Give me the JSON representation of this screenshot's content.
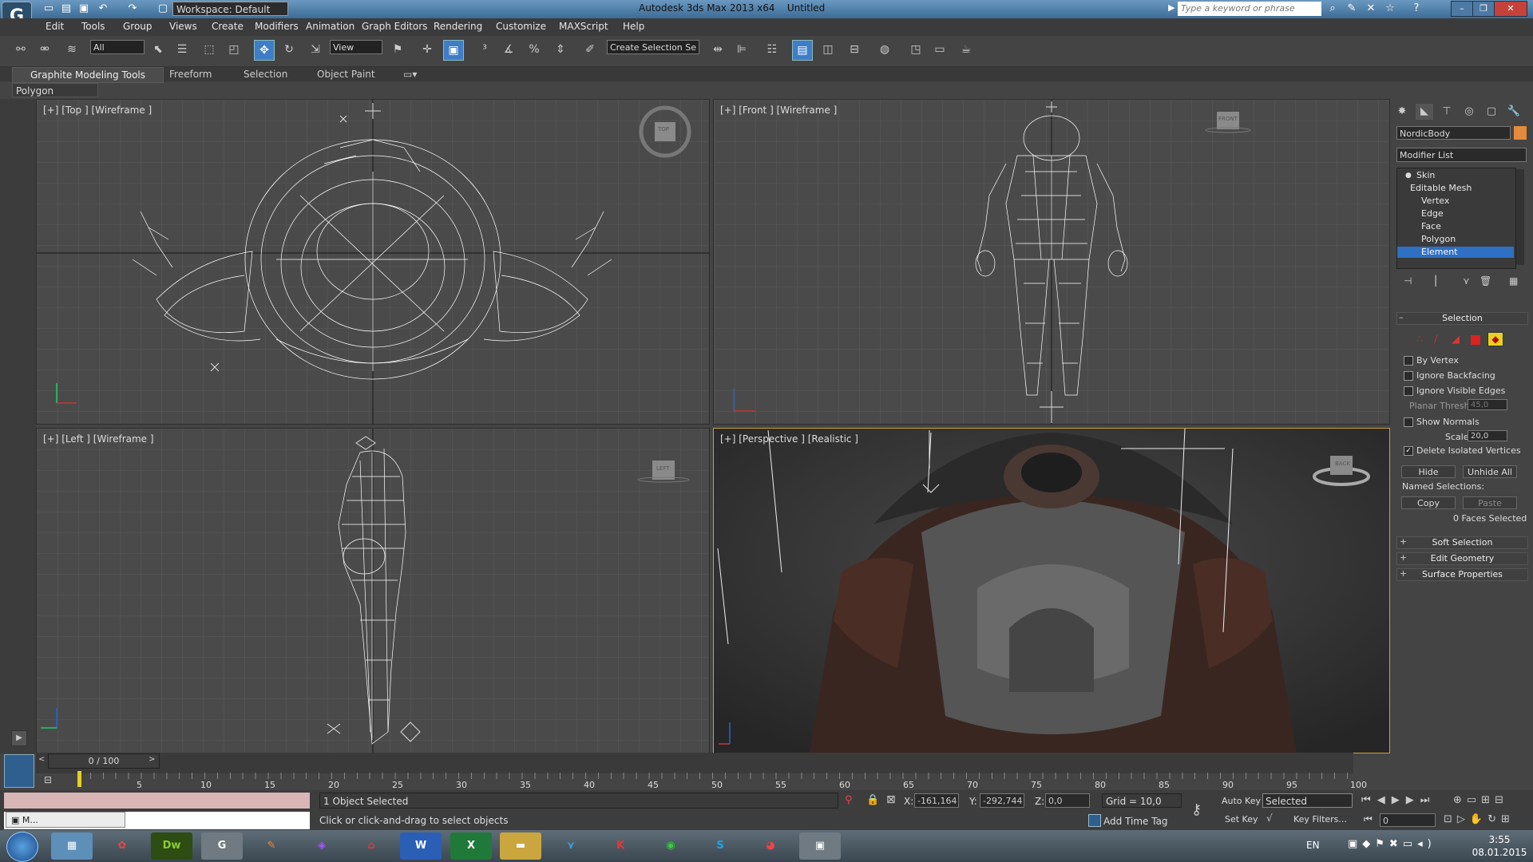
{
  "titlebar": {
    "workspace": "Workspace: Default",
    "app_title": "Autodesk 3ds Max  2013 x64",
    "doc_title": "Untitled",
    "search_placeholder": "Type a keyword or phrase"
  },
  "menu": [
    "Edit",
    "Tools",
    "Group",
    "Views",
    "Create",
    "Modifiers",
    "Animation",
    "Graph Editors",
    "Rendering",
    "Customize",
    "MAXScript",
    "Help"
  ],
  "toolbar": {
    "selection_filter": "All",
    "reference_coord": "View",
    "named_selection_set": "Create Selection Se"
  },
  "ribbon": {
    "tabs": [
      "Graphite Modeling Tools",
      "Freeform",
      "Selection",
      "Object Paint"
    ],
    "panel": "Polygon Modeling"
  },
  "viewports": {
    "top": {
      "label": "[+] [Top ] [Wireframe ]",
      "cube": "TOP"
    },
    "front": {
      "label": "[+] [Front ] [Wireframe ]",
      "cube": "FRONT"
    },
    "left": {
      "label": "[+] [Left ] [Wireframe ]",
      "cube": "LEFT"
    },
    "perspective": {
      "label": "[+] [Perspective ] [Realistic ]",
      "cube": "BACK"
    }
  },
  "command_panel": {
    "object_name": "NordicBody",
    "object_color": "#e58a3c",
    "modifier_list": "Modifier List",
    "stack": [
      "Skin",
      "Editable Mesh",
      "Vertex",
      "Edge",
      "Face",
      "Polygon",
      "Element"
    ],
    "selection": {
      "title": "Selection",
      "by_vertex": "By Vertex",
      "ignore_backfacing": "Ignore Backfacing",
      "ignore_visible_edges": "Ignore Visible Edges",
      "planar_thresh_label": "Planar Thresh:",
      "planar_thresh": "45,0",
      "show_normals": "Show Normals",
      "scale_label": "Scale:",
      "scale": "20,0",
      "delete_isolated": "Delete Isolated Vertices",
      "hide": "Hide",
      "unhide_all": "Unhide All",
      "named_selections": "Named Selections:",
      "copy": "Copy",
      "paste": "Paste",
      "faces_selected": "0 Faces Selected"
    },
    "rollouts": [
      "Soft Selection",
      "Edit Geometry",
      "Surface Properties"
    ]
  },
  "timeline": {
    "slider": "0 / 100",
    "ticks": [
      "5",
      "10",
      "15",
      "20",
      "25",
      "30",
      "35",
      "40",
      "45",
      "50",
      "55",
      "60",
      "65",
      "70",
      "75",
      "80",
      "85",
      "90",
      "95",
      "100"
    ]
  },
  "status": {
    "selection": "1 Object Selected",
    "prompt": "Click or click-and-drag to select objects",
    "x_label": "X:",
    "x": "-161,164",
    "y_label": "Y:",
    "y": "-292,744",
    "z_label": "Z:",
    "z": "0,0",
    "grid": "Grid = 10,0",
    "add_time_tag": "Add Time Tag",
    "auto_key": "Auto Key",
    "set_key": "Set Key",
    "key_mode": "Selected",
    "key_filters": "Key Filters...",
    "frame": "0",
    "mini_listener": "M..."
  },
  "taskbar": {
    "lang": "EN",
    "time": "3:55",
    "date": "08.01.2015",
    "apps": [
      "Dw",
      "W",
      "X",
      "S"
    ]
  }
}
